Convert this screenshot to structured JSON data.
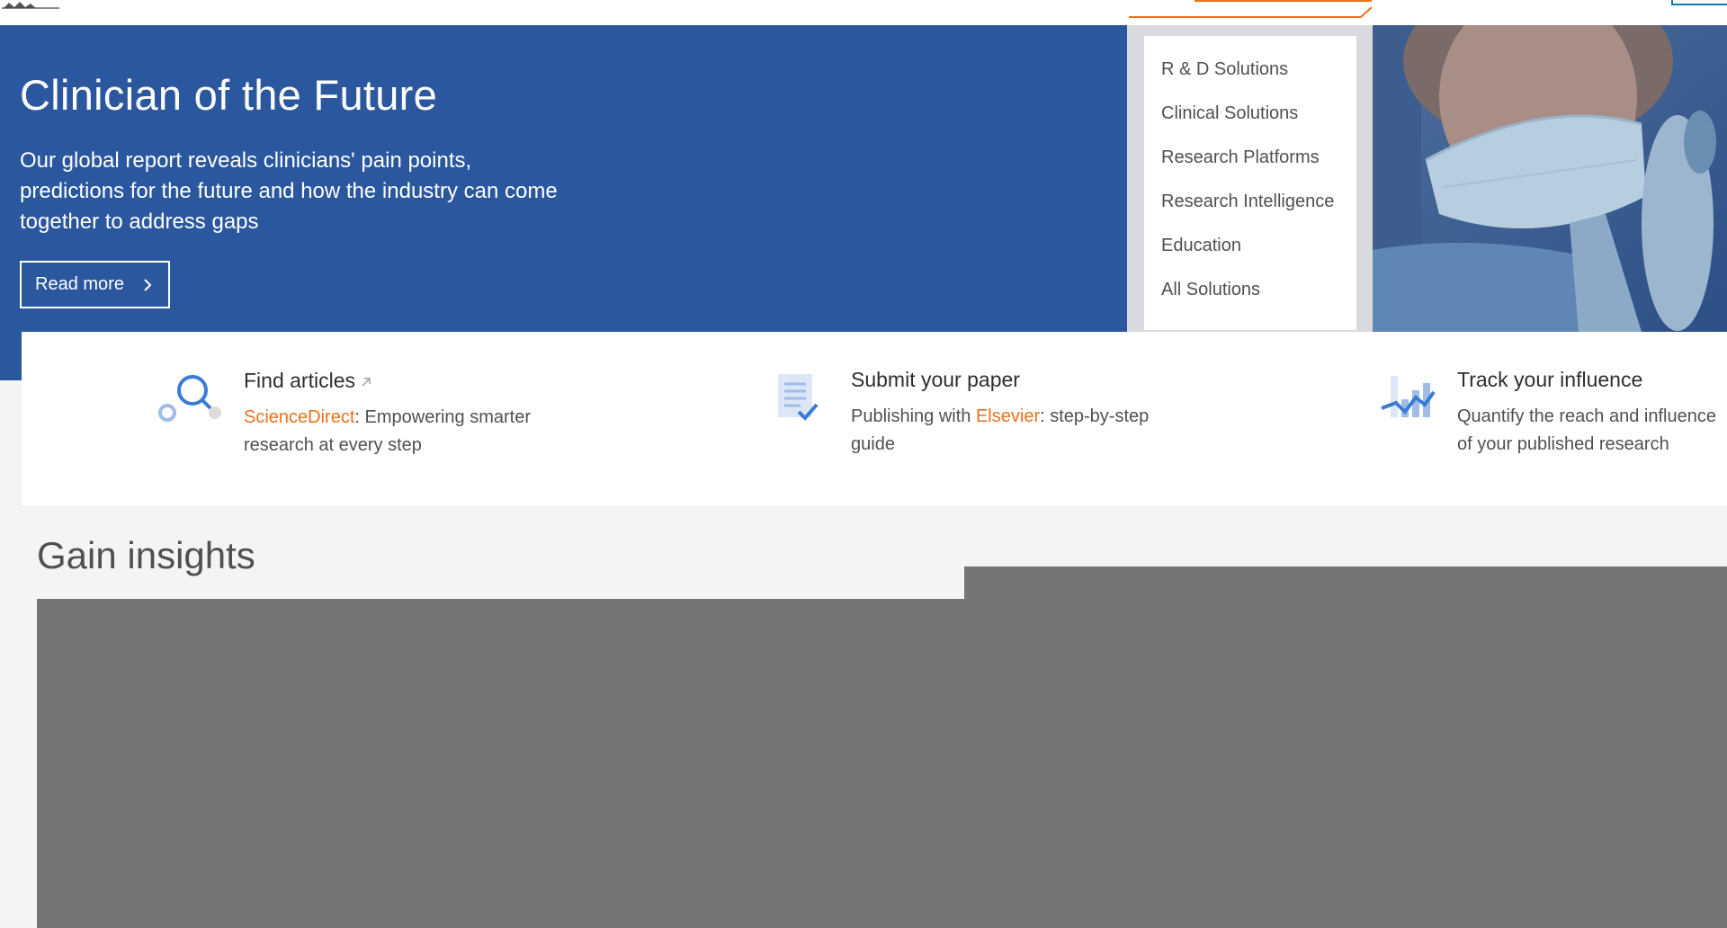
{
  "hero": {
    "title": "Clinician of the Future",
    "description": "Our global report reveals clinicians' pain points, predictions for the future and how the industry can come together to address gaps",
    "cta_label": "Read more",
    "background_color": "#2a579e"
  },
  "solutions_menu": {
    "items": [
      {
        "label": "R & D Solutions"
      },
      {
        "label": "Clinical Solutions"
      },
      {
        "label": "Research Platforms"
      },
      {
        "label": "Research Intelligence"
      },
      {
        "label": "Education"
      },
      {
        "label": "All Solutions"
      }
    ]
  },
  "cards": [
    {
      "title": "Find articles",
      "icon": "magnifier-icon",
      "link_text": "ScienceDirect",
      "desc_text": ": Empowering smarter research at every step"
    },
    {
      "title": "Submit your paper",
      "prefix_text": "Publishing with ",
      "link_text": "Elsevier",
      "desc_text": ": step-by-step guide",
      "icon": "document-check-icon"
    },
    {
      "title": "Track your influence",
      "desc_text": "Quantify the reach and influence of your published research",
      "icon": "chart-trend-icon"
    }
  ],
  "insights": {
    "title": "Gain insights"
  },
  "colors": {
    "accent": "#e9711c",
    "brand_blue": "#2a579e",
    "icon_blue": "#3a7bd5"
  }
}
